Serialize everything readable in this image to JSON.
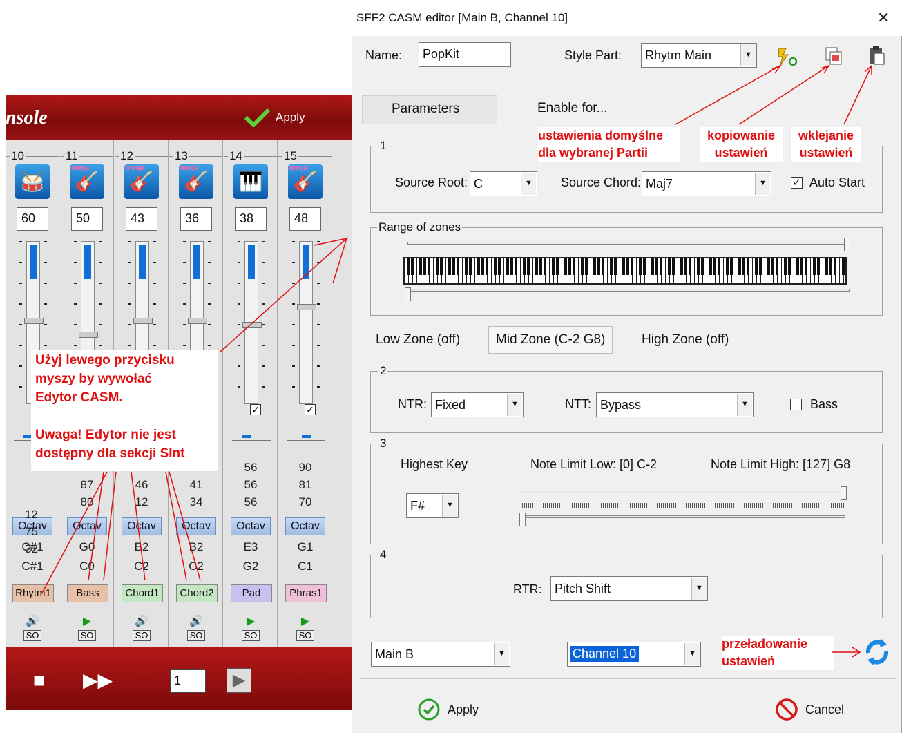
{
  "console": {
    "title": "nsole",
    "apply_label": "Apply",
    "page_value": "1",
    "channels": [
      {
        "num": "10",
        "vol": "60",
        "v1": "",
        "v2": "",
        "v3": "",
        "octav": "Octav",
        "k1": "C#1",
        "k2": "C#1",
        "part": "Rhytm1",
        "part_color": "#e7c0a8",
        "icon": "drums-icon",
        "mega": false,
        "level": 0.45,
        "play": "speaker"
      },
      {
        "num": "11",
        "vol": "50",
        "v1": "",
        "v2": "87",
        "v3": "80",
        "octav": "Octav",
        "k1": "G0",
        "k2": "C0",
        "part": "Bass",
        "part_color": "#e7c0a8",
        "icon": "bass-guitar-icon",
        "mega": true,
        "level": 0.35,
        "play": "play"
      },
      {
        "num": "12",
        "vol": "43",
        "v1": "",
        "v2": "46",
        "v3": "12",
        "octav": "Octav",
        "k1": "B2",
        "k2": "C2",
        "part": "Chord1",
        "part_color": "#c5e6c2",
        "icon": "acoustic-guitar-icon",
        "mega": true,
        "level": 0.45,
        "play": "speaker"
      },
      {
        "num": "13",
        "vol": "36",
        "v1": "",
        "v2": "41",
        "v3": "34",
        "octav": "Octav",
        "k1": "B2",
        "k2": "C2",
        "part": "Chord2",
        "part_color": "#c5e6c2",
        "icon": "electric-guitar-icon",
        "mega": true,
        "level": 0.45,
        "play": "speaker"
      },
      {
        "num": "14",
        "vol": "38",
        "v1": "56",
        "v2": "56",
        "v3": "56",
        "octav": "Octav",
        "k1": "E3",
        "k2": "G2",
        "part": "Pad",
        "part_color": "#c8c0ee",
        "icon": "pad-icon",
        "mega": false,
        "level": 0.42,
        "play": "play"
      },
      {
        "num": "15",
        "vol": "48",
        "v1": "90",
        "v2": "81",
        "v3": "70",
        "octav": "Octav",
        "k1": "G1",
        "k2": "C1",
        "part": "Phras1",
        "part_color": "#f0c0d8",
        "icon": "electric-guitar-icon",
        "mega": true,
        "level": 0.55,
        "play": "play"
      }
    ],
    "ch10_partial": "12\n75\n32",
    "so_label": "SO"
  },
  "note": {
    "lines": [
      "Użyj lewego przycisku",
      "myszy by wywołać",
      "Edytor CASM.",
      "",
      "Uwaga! Edytor nie jest",
      "dostępny dla sekcji SInt"
    ]
  },
  "dialog": {
    "title": "SFF2 CASM editor [Main B, Channel 10]",
    "close_glyph": "✕",
    "name_label": "Name:",
    "name_value": "PopKit",
    "style_part_label": "Style Part:",
    "style_part_value": "Rhytm Main",
    "tab_parameters": "Parameters",
    "tab_enable": "Enable for...",
    "group1": "1",
    "source_root_label": "Source Root:",
    "source_root_value": "C",
    "source_chord_label": "Source Chord:",
    "source_chord_value": "Maj7",
    "auto_start_label": "Auto Start",
    "range_label": "Range of zones",
    "zone_low": "Low Zone (off)",
    "zone_mid": "Mid Zone (C-2 G8)",
    "zone_high": "High Zone (off)",
    "group2": "2",
    "ntr_label": "NTR:",
    "ntr_value": "Fixed",
    "ntt_label": "NTT:",
    "ntt_value": "Bypass",
    "bass_label": "Bass",
    "group3": "3",
    "highest_key_label": "Highest Key",
    "highest_key_value": "F#",
    "note_limit_low": "Note Limit Low: [0] C-2",
    "note_limit_high": "Note Limit High:  [127] G8",
    "group4": "4",
    "rtr_label": "RTR:",
    "rtr_value": "Pitch Shift",
    "section_value": "Main B",
    "channel_value": "Channel 10",
    "apply_label": "Apply",
    "cancel_label": "Cancel"
  },
  "annotations": {
    "defaults": "ustawienia domyślne\ndla wybranej Partii",
    "copy": "kopiowanie\nustawień",
    "paste": "wklejanie\nustawień",
    "reload": "przeładowanie\nustawień"
  },
  "colors": {
    "annotation": "#e01010",
    "console_red": "#9a1010",
    "selected": "#0a64d8"
  }
}
